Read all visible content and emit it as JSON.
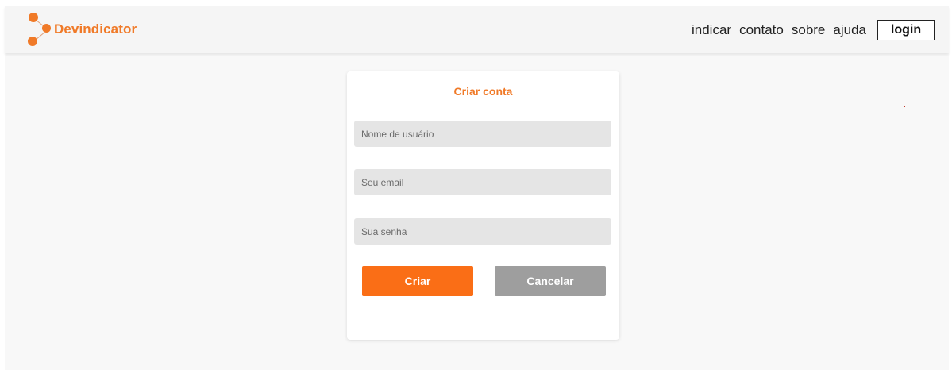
{
  "brand": {
    "name": "Devindicator",
    "accent_color": "#f07a28",
    "logo_icon": "molecule-icon"
  },
  "nav": {
    "links": [
      "indicar",
      "contato",
      "sobre",
      "ajuda"
    ],
    "login_label": "login"
  },
  "form": {
    "title": "Criar conta",
    "username_placeholder": "Nome de usuário",
    "email_placeholder": "Seu email",
    "password_placeholder": "Sua senha",
    "submit_label": "Criar",
    "cancel_label": "Cancelar",
    "submit_color": "#fa6e16",
    "cancel_color": "#9e9e9e"
  }
}
